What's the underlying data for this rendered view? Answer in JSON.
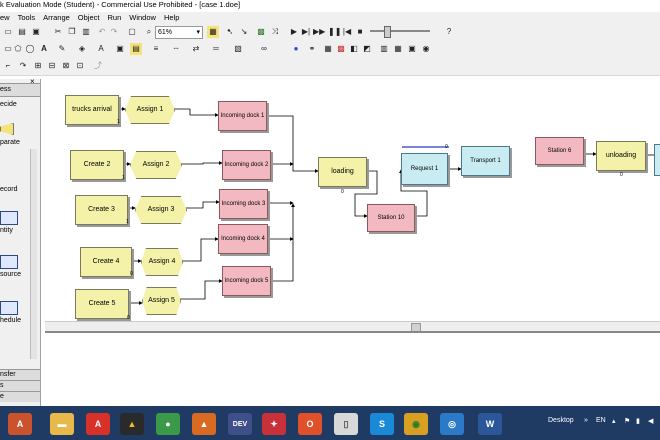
{
  "window": {
    "title": "k Evaluation Mode (Student) - Commercial Use Prohibited - [case 1.doe]"
  },
  "menu": [
    "ew",
    "Tools",
    "Arrange",
    "Object",
    "Run",
    "Window",
    "Help"
  ],
  "toolbar": {
    "zoom": "61%"
  },
  "project_bar": {
    "header": "ess",
    "modules": [
      "ecide",
      "parate",
      "ecord",
      "ntity",
      "source",
      "hedule"
    ],
    "footer": [
      "nsfer",
      "s",
      "e"
    ]
  },
  "flowchart": {
    "modules": [
      {
        "id": "trucks-arrival",
        "label": "trucks arrival",
        "kind": "create",
        "counter": "1"
      },
      {
        "id": "assign-1",
        "label": "Assign 1",
        "kind": "assign"
      },
      {
        "id": "incoming-dock-1",
        "label": "Incoming dock 1",
        "kind": "process"
      },
      {
        "id": "create-2",
        "label": "Create 2",
        "kind": "create",
        "counter": "1"
      },
      {
        "id": "assign-2",
        "label": "Assign 2",
        "kind": "assign"
      },
      {
        "id": "incoming-dock-2",
        "label": "Incoming dock 2",
        "kind": "process"
      },
      {
        "id": "create-3",
        "label": "Create 3",
        "kind": "create",
        "counter": "1"
      },
      {
        "id": "assign-3",
        "label": "Assign 3",
        "kind": "assign"
      },
      {
        "id": "incoming-dock-3",
        "label": "Incoming dock 3",
        "kind": "process"
      },
      {
        "id": "create-4",
        "label": "Create 4",
        "kind": "create",
        "counter": "0"
      },
      {
        "id": "assign-4",
        "label": "Assign 4",
        "kind": "assign"
      },
      {
        "id": "incoming-dock-4",
        "label": "Incoming dock 4",
        "kind": "process"
      },
      {
        "id": "create-5",
        "label": "Create 5",
        "kind": "create",
        "counter": "0"
      },
      {
        "id": "assign-5",
        "label": "Assign 5",
        "kind": "assign"
      },
      {
        "id": "incoming-dock-5",
        "label": "Incoming dock 5",
        "kind": "process"
      },
      {
        "id": "loading",
        "label": "loading",
        "kind": "process",
        "counter": "0"
      },
      {
        "id": "station-10",
        "label": "Station 10",
        "kind": "station"
      },
      {
        "id": "request-1",
        "label": "Request 1",
        "kind": "request",
        "counter": "0"
      },
      {
        "id": "transport-1",
        "label": "Transport 1",
        "kind": "transport"
      },
      {
        "id": "station-6",
        "label": "Station 6",
        "kind": "station"
      },
      {
        "id": "unloading",
        "label": "unloading",
        "kind": "process",
        "counter": "0"
      }
    ]
  },
  "taskbar": {
    "apps": [
      {
        "name": "arena",
        "glyph": "A",
        "color": "#c8532c"
      },
      {
        "name": "file-explorer",
        "glyph": "▬",
        "color": "#e8b84a"
      },
      {
        "name": "acrobat",
        "glyph": "A",
        "color": "#d8312a"
      },
      {
        "name": "archicad",
        "glyph": "▲",
        "color": "#2a2a2a"
      },
      {
        "name": "green-app",
        "glyph": "●",
        "color": "#3a9a4a"
      },
      {
        "name": "matlab",
        "glyph": "▲",
        "color": "#d86a22"
      },
      {
        "name": "dev-cpp",
        "glyph": "DEV",
        "color": "#3f4f8a"
      },
      {
        "name": "red-app",
        "glyph": "✦",
        "color": "#c8303a"
      },
      {
        "name": "office",
        "glyph": "O",
        "color": "#e0502a"
      },
      {
        "name": "notes",
        "glyph": "▯",
        "color": "#d8d8d8"
      },
      {
        "name": "skype",
        "glyph": "S",
        "color": "#1a8ad8"
      },
      {
        "name": "chrome",
        "glyph": "◉",
        "color": "#d8a020"
      },
      {
        "name": "globe",
        "glyph": "◎",
        "color": "#2a7ac8"
      },
      {
        "name": "word",
        "glyph": "W",
        "color": "#2b579a"
      }
    ],
    "tray": {
      "desktop": "Desktop",
      "lang": "EN"
    }
  }
}
